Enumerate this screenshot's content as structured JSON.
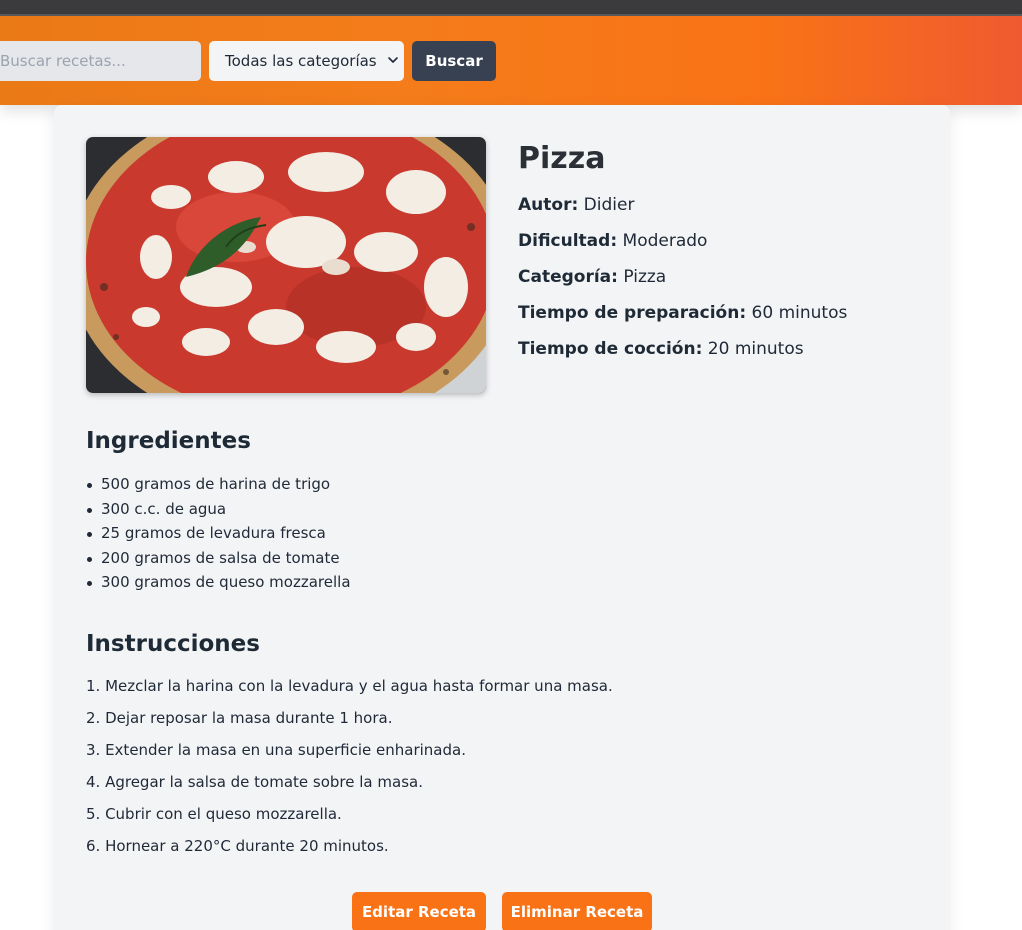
{
  "search": {
    "placeholder": "Buscar recetas...",
    "category_selected": "Todas las categorías",
    "button_label": "Buscar"
  },
  "recipe": {
    "title": "Pizza",
    "image_alt": "Pizza",
    "author_label": "Autor:",
    "author": "Didier",
    "difficulty_label": "Dificultad:",
    "difficulty": "Moderado",
    "category_label": "Categoría:",
    "category": "Pizza",
    "prep_label": "Tiempo de preparación:",
    "prep_time": "60 minutos",
    "cook_label": "Tiempo de cocción:",
    "cook_time": "20 minutos"
  },
  "ingredients": {
    "title": "Ingredientes",
    "items": [
      "500 gramos de harina de trigo",
      "300 c.c. de agua",
      "25 gramos de levadura fresca",
      "200 gramos de salsa de tomate",
      "300 gramos de queso mozzarella"
    ]
  },
  "instructions": {
    "title": "Instrucciones",
    "steps": [
      "1. Mezclar la harina con la levadura y el agua hasta formar una masa.",
      "2. Dejar reposar la masa durante 1 hora.",
      "3. Extender la masa en una superficie enharinada.",
      "4. Agregar la salsa de tomate sobre la masa.",
      "5. Cubrir con el queso mozzarella.",
      "6. Hornear a 220°C durante 20 minutos."
    ]
  },
  "actions": {
    "edit_label": "Editar Receta",
    "delete_label": "Eliminar Receta"
  },
  "colors": {
    "accent": "#f97316",
    "header_gradient_start": "#ea7a16",
    "header_gradient_end": "#f05a30",
    "search_button": "#374151",
    "card_background": "#f3f4f6"
  }
}
